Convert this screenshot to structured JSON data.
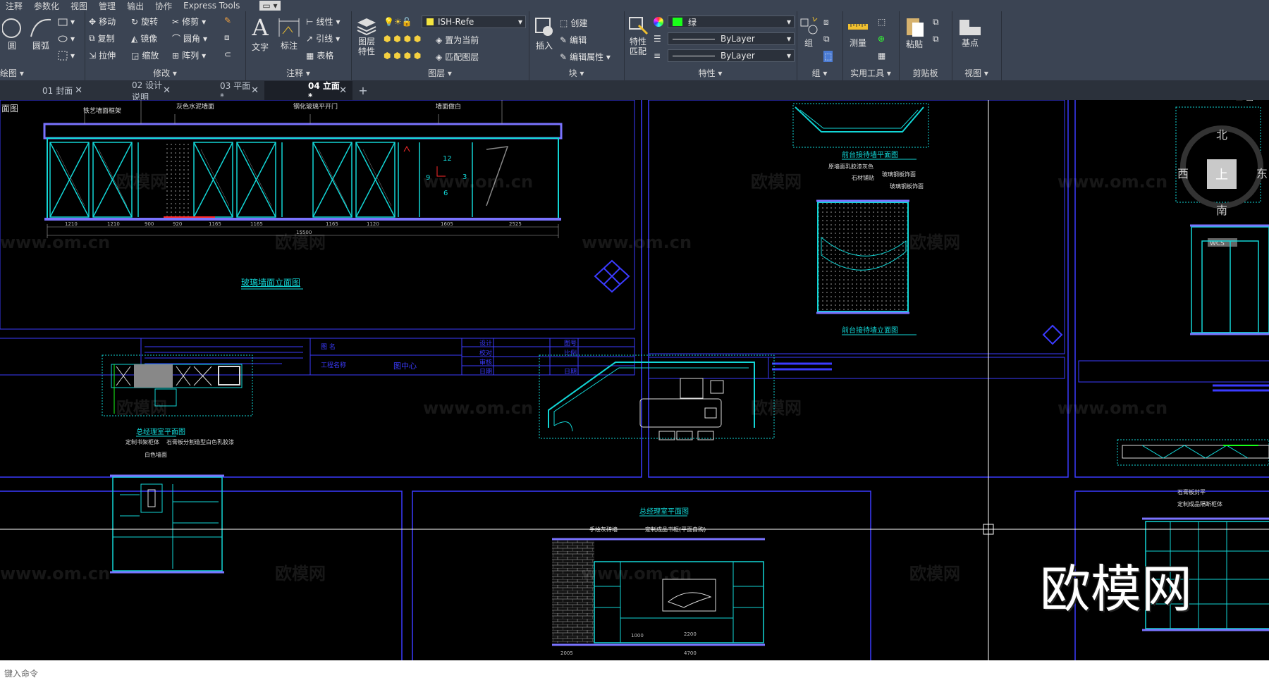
{
  "menu": [
    "注释",
    "参数化",
    "视图",
    "管理",
    "输出",
    "协作",
    "Express Tools",
    "▭ ▾"
  ],
  "ribbon": {
    "draw": {
      "circle": "圆",
      "arc": "圆弧",
      "title": "绘图 ▾"
    },
    "modify": {
      "items": [
        "移动",
        "旋转",
        "修剪",
        "复制",
        "镜像",
        "圆角",
        "拉伸",
        "缩放",
        "阵列"
      ],
      "title": "修改 ▾"
    },
    "annotation": {
      "text": "文字",
      "dim": "标注",
      "line": "线性",
      "leader": "引线",
      "table": "表格",
      "title": "注释 ▾"
    },
    "layers": {
      "props": "图层\n特性",
      "current": "ISH-Refe",
      "set_current": "置为当前",
      "match": "匹配图层",
      "title": "图层 ▾"
    },
    "block": {
      "insert": "插入",
      "create": "创建",
      "edit": "编辑",
      "edit_attr": "编辑属性 ▾",
      "title": "块 ▾"
    },
    "properties": {
      "match": "特性\n匹配",
      "color": "绿",
      "linetype": "ByLayer",
      "lineweight": "ByLayer",
      "title": "特性 ▾"
    },
    "groups": {
      "group": "组",
      "title": "组 ▾"
    },
    "utilities": {
      "measure": "测量",
      "title": "实用工具 ▾"
    },
    "clipboard": {
      "paste": "粘贴",
      "title": "剪贴板"
    },
    "view": {
      "base": "基点",
      "title": "视图 ▾"
    }
  },
  "tabs": [
    {
      "label": "01 封面"
    },
    {
      "label": "02 设计说明"
    },
    {
      "label": "03 平面*"
    },
    {
      "label": "04 立面*"
    }
  ],
  "colors": {
    "cyan": "#12d6d6",
    "blue": "#3b3bff",
    "purple": "#7a73ff",
    "red": "#ff2a2a",
    "white": "#ffffff",
    "green": "#19ff19"
  },
  "drawing": {
    "elev1_title": "玻璃墙面立面图",
    "corner_label": "面图",
    "elev1_notes": [
      "铁艺墙面框架",
      "灰色水泥墙面",
      "钢化玻璃平开门",
      "墙面做白"
    ],
    "elev1_dims": [
      "1210",
      "1210",
      "900",
      "920",
      "1165",
      "1165",
      "1165",
      "1120",
      "1605",
      "2525"
    ],
    "elev1_total": "15500",
    "elev1_marks": [
      "12",
      "9",
      "3",
      "6"
    ],
    "front_plan": "前台接待墙平面图",
    "front_elev": "前台接待墙立面图",
    "front_notes": [
      "原墙面乳胶漆灰色",
      "石材铺贴",
      "玻璃钢板饰面",
      "玻璃钢板饰面"
    ],
    "gm_plan": "总经理室平面图",
    "gm_notes": [
      "定制书架柜体",
      "石膏板分割造型白色乳胶漆",
      "白色墙面"
    ],
    "gm_plan2": "总经理室平面图",
    "gm_elev_notes": [
      "手绘灰砖墙",
      "定制成品书柜(平面自购)"
    ],
    "gm_elev_dims": [
      "2005",
      "2200",
      "1000",
      "4700"
    ],
    "right_notes": [
      "石膏板封平",
      "定制成品隔断柜体"
    ],
    "title_block": [
      "图 名",
      "工程名称",
      "图中心",
      "设计",
      "校对",
      "审核",
      "日期",
      "图号",
      "比例",
      "日期"
    ],
    "compass": {
      "n": "北",
      "s": "南",
      "e": "东",
      "w": "西",
      "center": "上",
      "wcs": "WCS"
    }
  },
  "watermarks": [
    "欧模网",
    "www.om.cn"
  ],
  "brand_watermark": "欧模网",
  "command_line": {
    "placeholder": "键入命令"
  }
}
